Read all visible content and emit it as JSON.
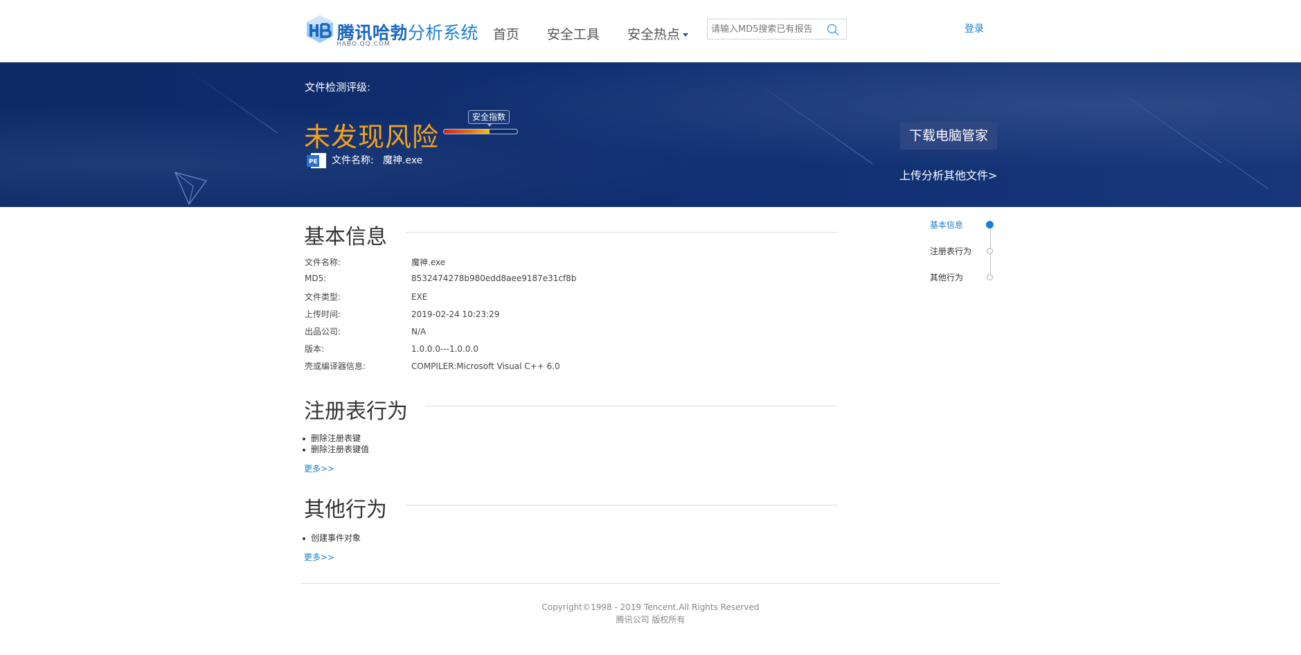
{
  "header": {
    "logo_title_bold": "腾讯哈勃",
    "logo_title_rest": "分析系统",
    "logo_subtitle": "HABO.QQ.COM",
    "nav": [
      {
        "label": "首页"
      },
      {
        "label": "安全工具"
      },
      {
        "label": "安全热点"
      }
    ],
    "search_placeholder": "请输入MD5搜索已有报告",
    "login_label": "登录"
  },
  "banner": {
    "rating_label": "文件检测评级:",
    "verdict": "未发现风险",
    "score_tag": "安全指数",
    "score_level": 0.62,
    "file_label": "文件名称:",
    "file_name": "魔神.exe",
    "download_button": "下载电脑管家",
    "upload_link": "上传分析其他文件>"
  },
  "sections": {
    "basic": {
      "title": "基本信息",
      "rows": [
        {
          "k": "文件名称:",
          "v": "魔神.exe"
        },
        {
          "k": "MD5:",
          "v": "8532474278b980edd8aee9187e31cf8b"
        },
        {
          "k": "文件类型:",
          "v": "EXE"
        },
        {
          "k": "上传时间:",
          "v": "2019-02-24 10:23:29"
        },
        {
          "k": "出品公司:",
          "v": "N/A"
        },
        {
          "k": "版本:",
          "v": "1.0.0.0---1.0.0.0"
        },
        {
          "k": "壳或编译器信息:",
          "v": "COMPILER:Microsoft Visual C++ 6.0"
        }
      ]
    },
    "registry": {
      "title": "注册表行为",
      "items": [
        "删除注册表键",
        "删除注册表键值"
      ],
      "more": "更多>>"
    },
    "other": {
      "title": "其他行为",
      "items": [
        "创建事件对象"
      ],
      "more": "更多>>"
    }
  },
  "side_nav": {
    "items": [
      "基本信息",
      "注册表行为",
      "其他行为"
    ]
  },
  "footer": {
    "copyright": "Copyright©1998 - 2019 Tencent.All Rights Reserved",
    "company": "腾讯公司 版权所有"
  },
  "colors": {
    "accent": "#1b7fd3",
    "banner_bg": "#0f2f72",
    "verdict": "#f7a21b"
  }
}
